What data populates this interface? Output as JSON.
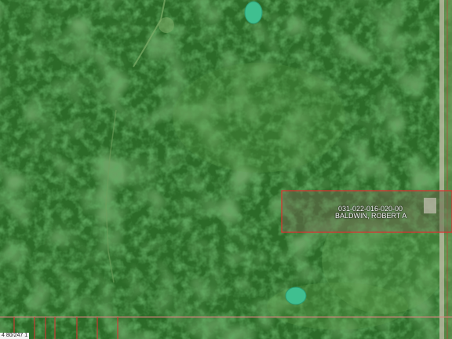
{
  "map": {
    "parcel": {
      "id": "031-022-016-020-00",
      "owner": "BALDWIN, ROBERT A"
    },
    "corner_label": "4 80/247 1",
    "colors": {
      "forest_dark": "#1f5a1e",
      "forest": "#2f6e2a",
      "forest_light": "#3f8a38",
      "clearing": "#5a9a48",
      "parcel_outline": "#e03030",
      "pond": "#3fbf8f",
      "road": "#b8b8a0"
    }
  }
}
